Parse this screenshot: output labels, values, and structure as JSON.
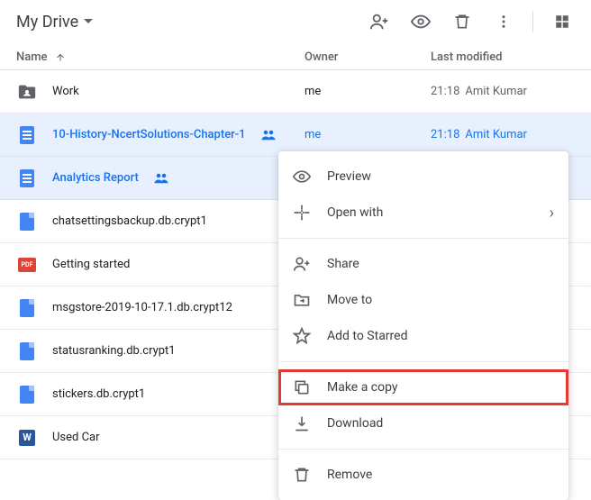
{
  "header": {
    "title": "My Drive"
  },
  "columns": {
    "name": "Name",
    "owner": "Owner",
    "modified": "Last modified"
  },
  "rows": [
    {
      "icon": "shared-folder",
      "name": "Work",
      "owner": "me",
      "time": "21:18",
      "user": "Amit Kumar",
      "selected": false,
      "shared": false
    },
    {
      "icon": "doc",
      "name": "10-History-NcertSolutions-Chapter-1",
      "owner": "me",
      "time": "21:18",
      "user": "Amit Kumar",
      "selected": true,
      "shared": true
    },
    {
      "icon": "doc",
      "name": "Analytics Report",
      "owner": "",
      "time": "",
      "user": "",
      "selected": true,
      "shared": true
    },
    {
      "icon": "file",
      "name": "chatsettingsbackup.db.crypt1",
      "owner": "",
      "time": "",
      "user": "",
      "selected": false,
      "shared": false
    },
    {
      "icon": "pdf",
      "name": "Getting started",
      "owner": "",
      "time": "",
      "user": "",
      "selected": false,
      "shared": false
    },
    {
      "icon": "file",
      "name": "msgstore-2019-10-17.1.db.crypt12",
      "owner": "",
      "time": "",
      "user": "",
      "selected": false,
      "shared": false
    },
    {
      "icon": "file",
      "name": "statusranking.db.crypt1",
      "owner": "",
      "time": "",
      "user": "",
      "selected": false,
      "shared": false
    },
    {
      "icon": "file",
      "name": "stickers.db.crypt1",
      "owner": "",
      "time": "",
      "user": "",
      "selected": false,
      "shared": false
    },
    {
      "icon": "word",
      "name": "Used Car",
      "owner": "",
      "time": "",
      "user": "",
      "selected": false,
      "shared": false
    }
  ],
  "context_menu": {
    "preview": "Preview",
    "open_with": "Open with",
    "share": "Share",
    "move_to": "Move to",
    "add_starred": "Add to Starred",
    "make_copy": "Make a copy",
    "download": "Download",
    "remove": "Remove"
  }
}
